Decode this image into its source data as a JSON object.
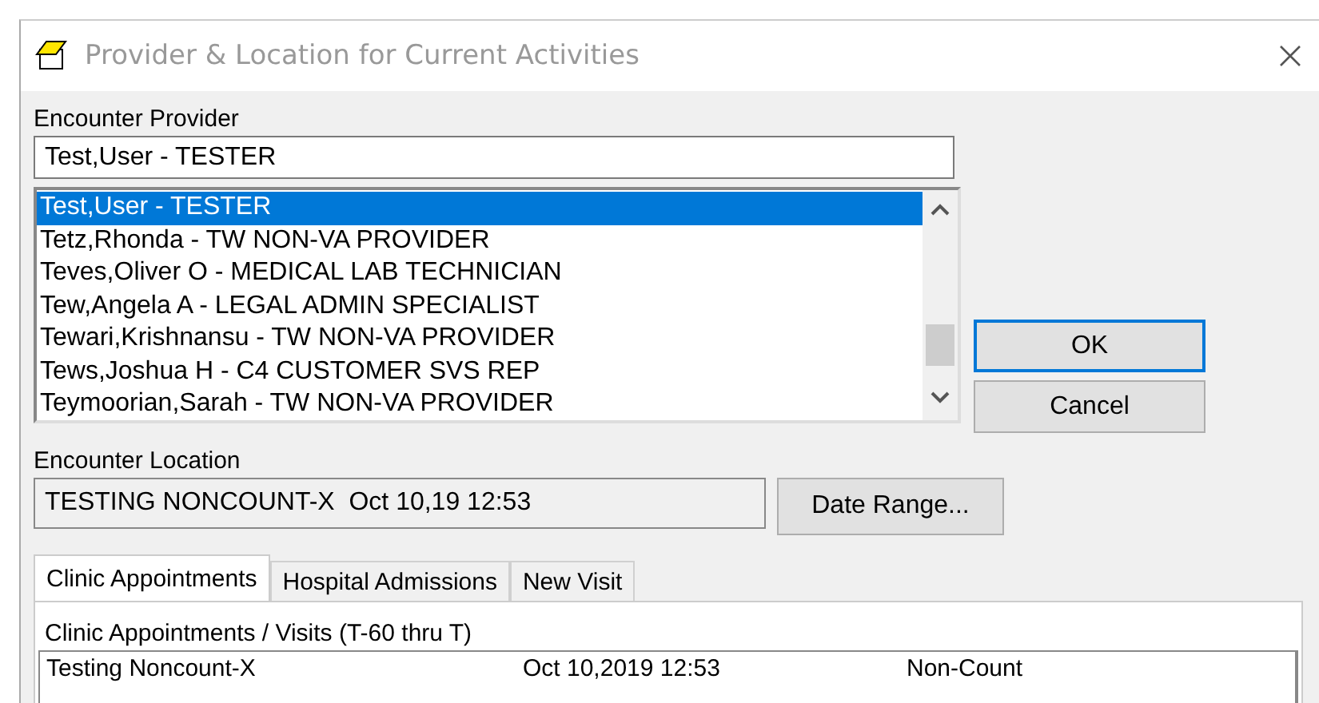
{
  "window": {
    "title": "Provider & Location for Current Activities"
  },
  "provider": {
    "label": "Encounter Provider",
    "value": "Test,User - TESTER",
    "list": [
      {
        "text": "Test,User - TESTER",
        "selected": true
      },
      {
        "text": "Tetz,Rhonda - TW NON-VA PROVIDER",
        "selected": false
      },
      {
        "text": "Teves,Oliver O - MEDICAL LAB TECHNICIAN",
        "selected": false
      },
      {
        "text": "Tew,Angela A - LEGAL ADMIN SPECIALIST",
        "selected": false
      },
      {
        "text": "Tewari,Krishnansu - TW NON-VA PROVIDER",
        "selected": false
      },
      {
        "text": "Tews,Joshua H - C4 CUSTOMER SVS REP",
        "selected": false
      },
      {
        "text": "Teymoorian,Sarah - TW NON-VA PROVIDER",
        "selected": false
      }
    ]
  },
  "buttons": [
    "OK",
    "Cancel"
  ],
  "location": {
    "label": "Encounter Location",
    "value": "TESTING NONCOUNT-X  Oct 10,19 12:53",
    "button": "Date Range..."
  },
  "tabs": [
    {
      "label": "Clinic Appointments",
      "selected": true
    },
    {
      "label": "Hospital Admissions",
      "selected": false
    },
    {
      "label": "New Visit",
      "selected": false
    }
  ],
  "panel": {
    "label": "Clinic Appointments / Visits  (T-60 thru T)",
    "rows": [
      [
        "Testing Noncount-X",
        "Oct 10,2019 12:53",
        "Non-Count"
      ]
    ]
  }
}
